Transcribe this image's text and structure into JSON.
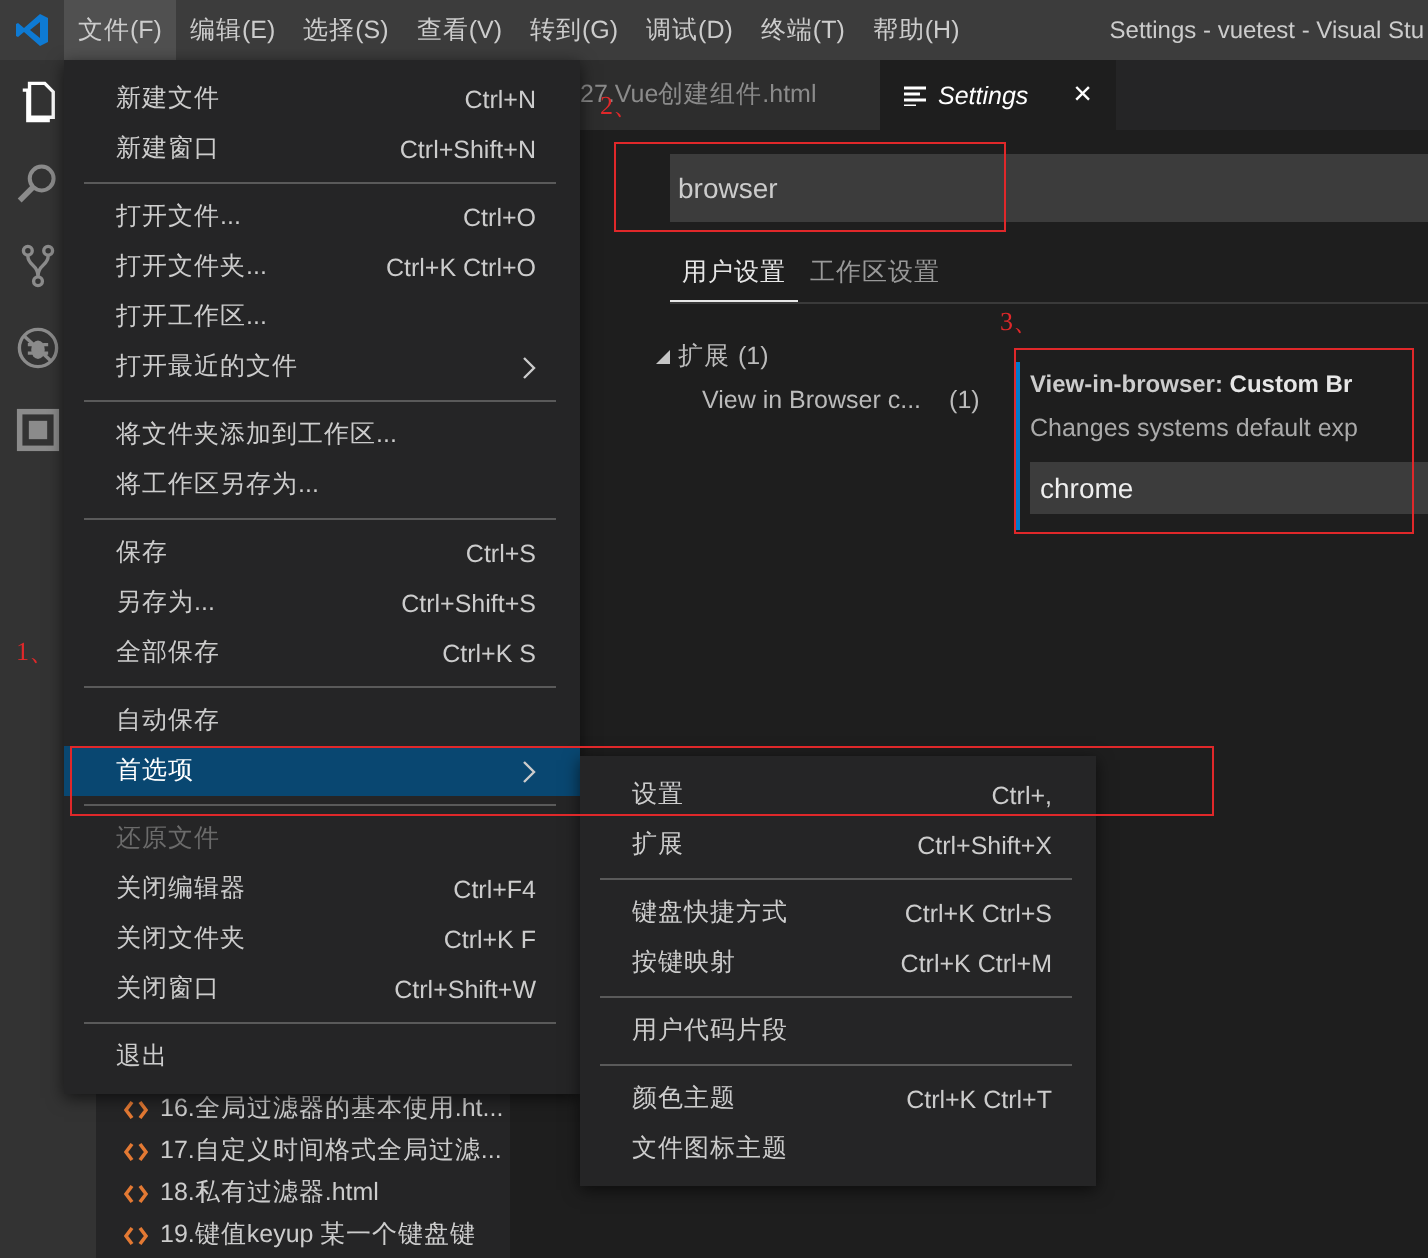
{
  "titlebar": {
    "menus": [
      {
        "label": "文件(F)",
        "selected": true
      },
      {
        "label": "编辑(E)",
        "selected": false
      },
      {
        "label": "选择(S)",
        "selected": false
      },
      {
        "label": "查看(V)",
        "selected": false
      },
      {
        "label": "转到(G)",
        "selected": false
      },
      {
        "label": "调试(D)",
        "selected": false
      },
      {
        "label": "终端(T)",
        "selected": false
      },
      {
        "label": "帮助(H)",
        "selected": false
      }
    ],
    "title": "Settings - vuetest - Visual Stu"
  },
  "explorer": {
    "files": [
      "16.全局过滤器的基本使用.ht...",
      "17.自定义时间格式全局过滤...",
      "18.私有过滤器.html",
      "19.键值keyup 某一个键盘键"
    ]
  },
  "tabs": [
    {
      "label": "27.Vue创建组件.html",
      "selected": false
    },
    {
      "label": "Settings",
      "selected": true,
      "close": "×"
    }
  ],
  "search": {
    "value": "browser"
  },
  "settings_tabs": [
    {
      "label": "用户设置",
      "selected": true
    },
    {
      "label": "工作区设置",
      "selected": false
    }
  ],
  "tree": [
    {
      "label": "扩展",
      "count": "(1)",
      "expanded": true,
      "children": [
        {
          "label": "View in Browser c...",
          "count": "(1)"
        }
      ]
    }
  ],
  "setting": {
    "category": "View-in-browser: ",
    "name": "Custom Br",
    "description": "Changes systems default exp",
    "value": "chrome"
  },
  "file_menu": [
    {
      "kind": "item",
      "label": "新建文件",
      "shortcut": "Ctrl+N",
      "submenu": false,
      "disabled": false,
      "selected": false
    },
    {
      "kind": "item",
      "label": "新建窗口",
      "shortcut": "Ctrl+Shift+N",
      "submenu": false,
      "disabled": false,
      "selected": false
    },
    {
      "kind": "separator"
    },
    {
      "kind": "item",
      "label": "打开文件...",
      "shortcut": "Ctrl+O",
      "submenu": false,
      "disabled": false,
      "selected": false
    },
    {
      "kind": "item",
      "label": "打开文件夹...",
      "shortcut": "Ctrl+K Ctrl+O",
      "submenu": false,
      "disabled": false,
      "selected": false
    },
    {
      "kind": "item",
      "label": "打开工作区...",
      "submenu": false,
      "disabled": false,
      "selected": false
    },
    {
      "kind": "item",
      "label": "打开最近的文件",
      "submenu": true,
      "disabled": false,
      "selected": false
    },
    {
      "kind": "separator"
    },
    {
      "kind": "item",
      "label": "将文件夹添加到工作区...",
      "submenu": false,
      "disabled": false,
      "selected": false
    },
    {
      "kind": "item",
      "label": "将工作区另存为...",
      "submenu": false,
      "disabled": false,
      "selected": false
    },
    {
      "kind": "separator"
    },
    {
      "kind": "item",
      "label": "保存",
      "shortcut": "Ctrl+S",
      "submenu": false,
      "disabled": false,
      "selected": false
    },
    {
      "kind": "item",
      "label": "另存为...",
      "shortcut": "Ctrl+Shift+S",
      "submenu": false,
      "disabled": false,
      "selected": false
    },
    {
      "kind": "item",
      "label": "全部保存",
      "shortcut": "Ctrl+K S",
      "submenu": false,
      "disabled": false,
      "selected": false
    },
    {
      "kind": "separator"
    },
    {
      "kind": "item",
      "label": "自动保存",
      "submenu": false,
      "disabled": false,
      "selected": false
    },
    {
      "kind": "item",
      "label": "首选项",
      "submenu": true,
      "disabled": false,
      "selected": true
    },
    {
      "kind": "separator"
    },
    {
      "kind": "item",
      "label": "还原文件",
      "submenu": false,
      "disabled": true,
      "selected": false
    },
    {
      "kind": "item",
      "label": "关闭编辑器",
      "shortcut": "Ctrl+F4",
      "submenu": false,
      "disabled": false,
      "selected": false
    },
    {
      "kind": "item",
      "label": "关闭文件夹",
      "shortcut": "Ctrl+K F",
      "submenu": false,
      "disabled": false,
      "selected": false
    },
    {
      "kind": "item",
      "label": "关闭窗口",
      "shortcut": "Ctrl+Shift+W",
      "submenu": false,
      "disabled": false,
      "selected": false
    },
    {
      "kind": "separator"
    },
    {
      "kind": "item",
      "label": "退出",
      "submenu": false,
      "disabled": false,
      "selected": false
    }
  ],
  "preferences_menu": [
    {
      "kind": "item",
      "label": "设置",
      "shortcut": "Ctrl+,",
      "submenu": false,
      "disabled": false,
      "selected": false
    },
    {
      "kind": "item",
      "label": "扩展",
      "shortcut": "Ctrl+Shift+X",
      "submenu": false,
      "disabled": false,
      "selected": false
    },
    {
      "kind": "separator"
    },
    {
      "kind": "item",
      "label": "键盘快捷方式",
      "shortcut": "Ctrl+K Ctrl+S",
      "submenu": false,
      "disabled": false,
      "selected": false
    },
    {
      "kind": "item",
      "label": "按键映射",
      "shortcut": "Ctrl+K Ctrl+M",
      "submenu": false,
      "disabled": false,
      "selected": false
    },
    {
      "kind": "separator"
    },
    {
      "kind": "item",
      "label": "用户代码片段",
      "submenu": false,
      "disabled": false,
      "selected": false
    },
    {
      "kind": "separator"
    },
    {
      "kind": "item",
      "label": "颜色主题",
      "shortcut": "Ctrl+K Ctrl+T",
      "submenu": false,
      "disabled": false,
      "selected": false
    },
    {
      "kind": "item",
      "label": "文件图标主题",
      "submenu": false,
      "disabled": false,
      "selected": false
    }
  ],
  "annotations": [
    {
      "number": "1、"
    },
    {
      "number": "2、"
    },
    {
      "number": "3、"
    }
  ]
}
